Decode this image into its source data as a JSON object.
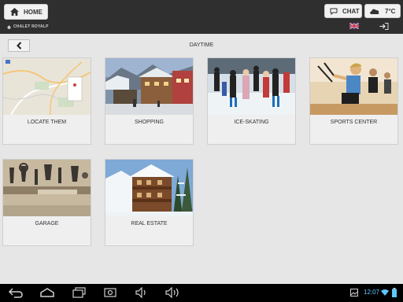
{
  "header": {
    "home_label": "HOME",
    "chat_label": "CHAT",
    "temperature": "7°C",
    "brand": "CHALET ROYALP",
    "language": "English (UK)"
  },
  "main": {
    "section_title": "DAYTIME",
    "tiles": [
      {
        "label": "LOCATE THEM",
        "image": "map-thumbnail"
      },
      {
        "label": "SHOPPING",
        "image": "village-street-photo"
      },
      {
        "label": "ICE-SKATING",
        "image": "ice-skating-photo"
      },
      {
        "label": "SPORTS CENTER",
        "image": "fitness-class-photo"
      },
      {
        "label": "GARAGE",
        "image": "garage-tools-photo"
      },
      {
        "label": "REAL ESTATE",
        "image": "chalet-in-snow-photo"
      }
    ]
  },
  "system_bar": {
    "time": "12:07",
    "icons": [
      "back-icon",
      "home-icon",
      "recent-apps-icon",
      "screenshot-icon",
      "volume-down-icon",
      "volume-up-icon",
      "gallery-icon",
      "android-icon",
      "wifi-icon",
      "battery-icon"
    ]
  },
  "colors": {
    "topbar": "#2f2f2f",
    "content_bg": "#e6e6e6",
    "clock": "#5ec7ff"
  }
}
